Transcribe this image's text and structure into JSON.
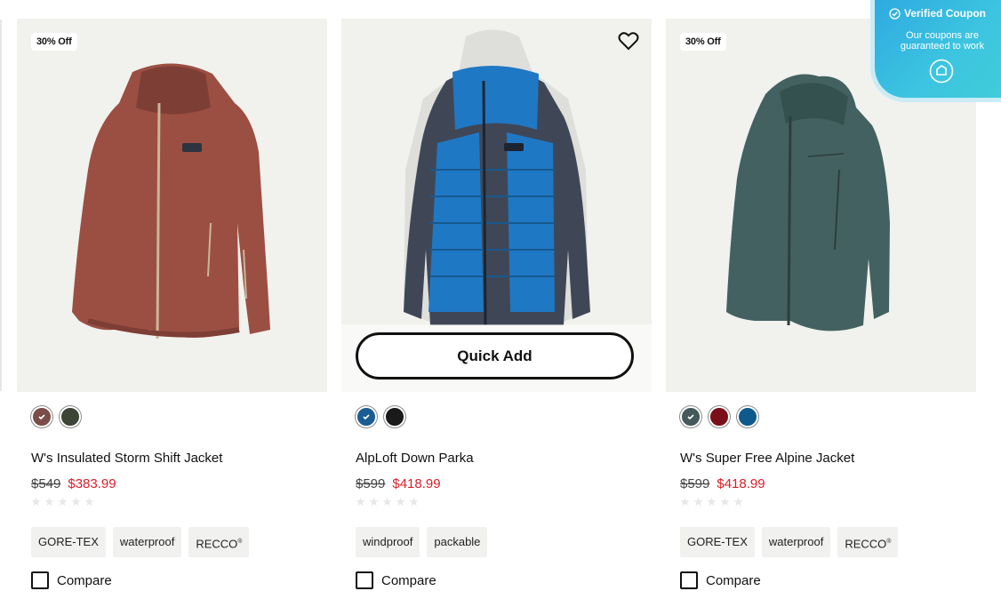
{
  "products": [
    {
      "badge": "30% Off",
      "title": "W's Insulated Storm Shift Jacket",
      "old_price": "$549",
      "new_price": "$383.99",
      "swatches": [
        "#7a4e48",
        "#3d4536"
      ],
      "tags": [
        "GORE-TEX",
        "waterproof",
        "RECCO"
      ],
      "compare": "Compare",
      "jacket_color": "#9b4f42"
    },
    {
      "title": "AlpLoft Down Parka",
      "old_price": "$599",
      "new_price": "$418.99",
      "swatches": [
        "#1b5d93",
        "#1a1a1a"
      ],
      "tags": [
        "windproof",
        "packable"
      ],
      "compare": "Compare",
      "quick_add": "Quick Add",
      "jacket_color": "#1f78c4"
    },
    {
      "badge": "30% Off",
      "title": "W's Super Free Alpine Jacket",
      "old_price": "$599",
      "new_price": "$418.99",
      "swatches": [
        "#45585a",
        "#7a0f1a",
        "#0f5a8c"
      ],
      "tags": [
        "GORE-TEX",
        "waterproof",
        "RECCO"
      ],
      "compare": "Compare",
      "jacket_color": "#436160"
    }
  ],
  "coupon": {
    "title": "Verified Coupon",
    "text": "Our coupons are guaranteed to work"
  }
}
